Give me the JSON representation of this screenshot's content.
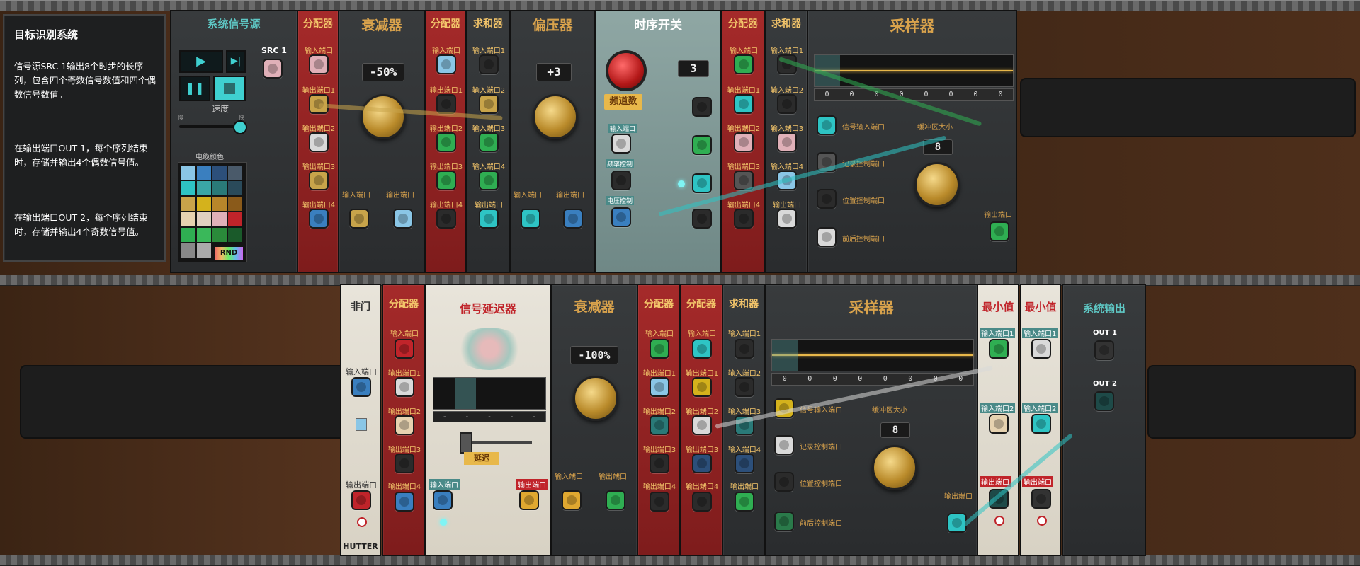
{
  "info": {
    "title": "目标识别系统",
    "p1": "信号源SRC 1输出8个时步的长序列，包含四个奇数信号数值和四个偶数信号数值。",
    "p2": "在输出端口OUT 1，每个序列结束时，存储并输出4个偶数信号值。",
    "p3": "在输出端口OUT 2，每个序列结束时，存储并输出4个奇数信号值。"
  },
  "source": {
    "title": "系统信号源",
    "src": "SRC 1",
    "speed": "速度",
    "slow": "慢",
    "fast": "快",
    "palette": "电缆颜色",
    "rnd": "RND"
  },
  "splitter": {
    "title": "分配器",
    "in": "输入端口",
    "out1": "输出端口1",
    "out2": "输出端口2",
    "out3": "输出端口3",
    "out4": "输出端口4"
  },
  "adder": {
    "title": "求和器",
    "in1": "输入端口1",
    "in2": "输入端口2",
    "in3": "输入端口3",
    "in4": "输入端口4",
    "out": "输出端口"
  },
  "attenuator1": {
    "title": "衰减器",
    "value": "-50%",
    "in": "输入端口",
    "out": "输出端口"
  },
  "offset": {
    "title": "偏压器",
    "value": "+3",
    "in": "输入端口",
    "out": "输出端口"
  },
  "switch": {
    "title": "时序开关",
    "value": "3",
    "channels": "频道数",
    "in": "输入端口",
    "trigger": "频率控制",
    "voltage": "电压控制"
  },
  "sampler1": {
    "title": "采样器",
    "value": "8",
    "signal_in": "信号输入端口",
    "record": "记录控制端口",
    "position": "位置控制端口",
    "prevnext": "前后控制端口",
    "buffer": "缓冲区大小",
    "out": "输出端口",
    "cells": [
      "0",
      "0",
      "0",
      "0",
      "0",
      "0",
      "0",
      "0"
    ]
  },
  "not_gate": {
    "title": "非门",
    "in": "输入端口",
    "out": "输出端口",
    "brand": "HUTTER"
  },
  "delay": {
    "title": "信号延迟器",
    "in": "输入端口",
    "out": "输出端口",
    "delay": "延迟",
    "cells": [
      "-",
      "-",
      "-",
      "-",
      "-"
    ]
  },
  "attenuator2": {
    "title": "衰减器",
    "value": "-100%",
    "in": "输入端口",
    "out": "输出端口"
  },
  "sampler2": {
    "title": "采样器",
    "value": "8",
    "signal_in": "信号输入端口",
    "record": "记录控制端口",
    "position": "位置控制端口",
    "prevnext": "前后控制端口",
    "buffer": "缓冲区大小",
    "out": "输出端口",
    "cells": [
      "0",
      "0",
      "0",
      "0",
      "0",
      "0",
      "0",
      "0"
    ]
  },
  "min1": {
    "title": "最小值",
    "in1": "输入端口1",
    "in2": "输入端口2",
    "out": "输出端口"
  },
  "min2": {
    "title": "最小值",
    "in1": "输入端口1",
    "in2": "输入端口2",
    "out": "输出端口"
  },
  "output": {
    "title": "系统输出",
    "out1": "OUT 1",
    "out2": "OUT 2"
  },
  "colors": {
    "teal": "#2ec4c4",
    "green": "#2fae52",
    "blue": "#3a7fbf",
    "gold": "#c8a44a",
    "white": "#d9d9d9",
    "pink": "#e0b0b8",
    "yellow": "#d4b21c",
    "red": "#c0242a",
    "dark": "#2b2b2b",
    "cream": "#e6d2b0",
    "navy": "#2c4f7a",
    "lightblue": "#8ac6e6"
  }
}
